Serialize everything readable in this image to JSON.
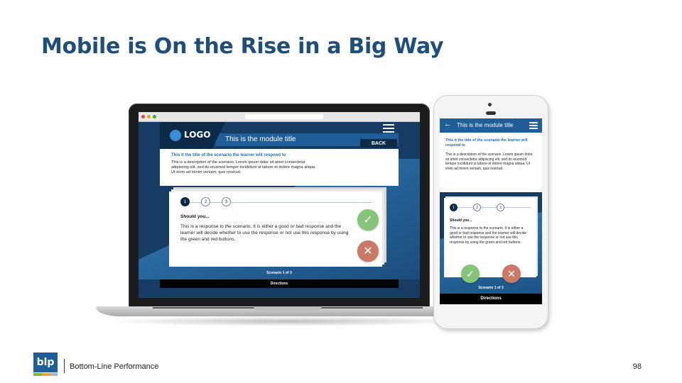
{
  "slide": {
    "title": "Mobile is On the Rise in a Big Way",
    "page_number": "98"
  },
  "footer": {
    "logo_text": "blp",
    "company": "Bottom-Line Performance"
  },
  "laptop_app": {
    "logo_text": "LOGO",
    "module_title": "This is the module title",
    "back_label": "BACK",
    "scenario_title": "This it the title of the scenario the learner will respond to",
    "scenario_description": "This is a description of the scenario. Lorem ipsum dolor sit amet consectetur adipiscing elit, sed do eiusmod tempor incididunt ut labore et dolore magna aliqua. Ut enim ad minim veniam, quis nostrud.",
    "steps": [
      "1",
      "2",
      "3"
    ],
    "question": "Should you...",
    "response": "This is a response to the scenario. It is either a good or bad response and the learner will decide whether to use the response or not use this response by using the green and red buttons.",
    "counter": "Scenario 1 of 3",
    "directions": "Directions"
  },
  "phone_app": {
    "module_title": "This is the module title",
    "scenario_title": "This it the title of the scenario the learner will respond to",
    "scenario_description": "This is a description of the scenario. Lorem ipsum dolor sit amet consectetur adipiscing elit, sed do eiusmod tempor incididunt ut labore et dolore magna aliqua. Ut enim ad minim veniam, quis nostrud.",
    "steps": [
      "1",
      "2",
      "3"
    ],
    "question": "Should you...",
    "response": "This is a response to the scenario. It is either a good or bad response and the learner will decide whether to use the response or not use this response by using the green and red buttons.",
    "counter": "Scenario 1 of 3",
    "directions": "Directions"
  },
  "icons": {
    "check": "check-icon",
    "cross": "close-icon",
    "menu": "hamburger-menu-icon",
    "back_arrow": "arrow-left-icon"
  },
  "colors": {
    "title": "#1f4e79",
    "header_blue": "#1f5e98",
    "navy": "#0c2a48",
    "accept_green": "#86c47a",
    "reject_red": "#c97965"
  }
}
